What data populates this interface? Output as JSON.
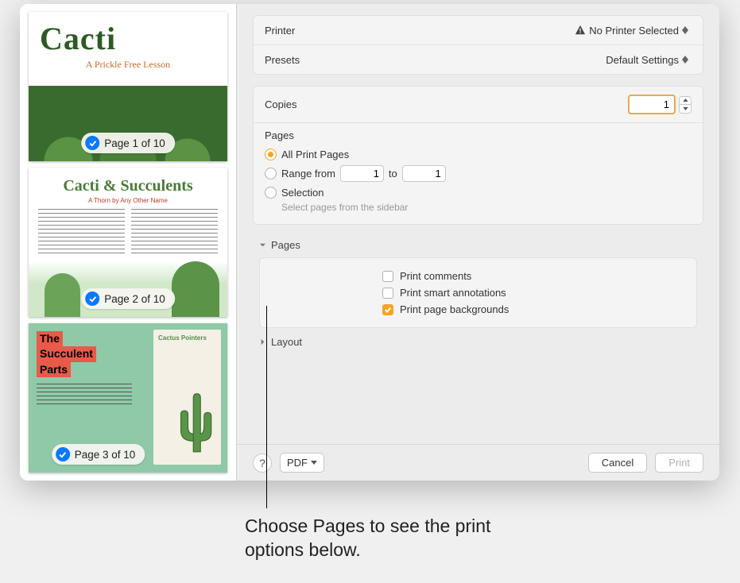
{
  "sidebar": {
    "pages": [
      {
        "label": "Page 1 of 10",
        "doc_title": "Cacti",
        "doc_subtitle": "A Prickle Free Lesson"
      },
      {
        "label": "Page 2 of 10",
        "doc_title": "Cacti & Succulents",
        "doc_subtitle": "A Thorn by Any Other Name"
      },
      {
        "label": "Page 3 of 10",
        "doc_title_a": "The",
        "doc_title_b": "Succulent",
        "doc_title_c": "Parts",
        "card_title": "Cactus Pointers"
      }
    ]
  },
  "printer": {
    "label": "Printer",
    "value": "No Printer Selected"
  },
  "presets": {
    "label": "Presets",
    "value": "Default Settings"
  },
  "copies": {
    "label": "Copies",
    "value": "1"
  },
  "pages": {
    "heading": "Pages",
    "all_label": "All Print Pages",
    "range_from_label": "Range from",
    "range_to_label": "to",
    "range_from": "1",
    "range_to": "1",
    "selection_label": "Selection",
    "selection_hint": "Select pages from the sidebar"
  },
  "disclosure_pages": {
    "title": "Pages",
    "opt_comments": "Print comments",
    "opt_annotations": "Print smart annotations",
    "opt_backgrounds": "Print page backgrounds"
  },
  "disclosure_layout": {
    "title": "Layout"
  },
  "footer": {
    "help": "?",
    "pdf": "PDF",
    "cancel": "Cancel",
    "print": "Print"
  },
  "callout": "Choose Pages to see the print options below."
}
